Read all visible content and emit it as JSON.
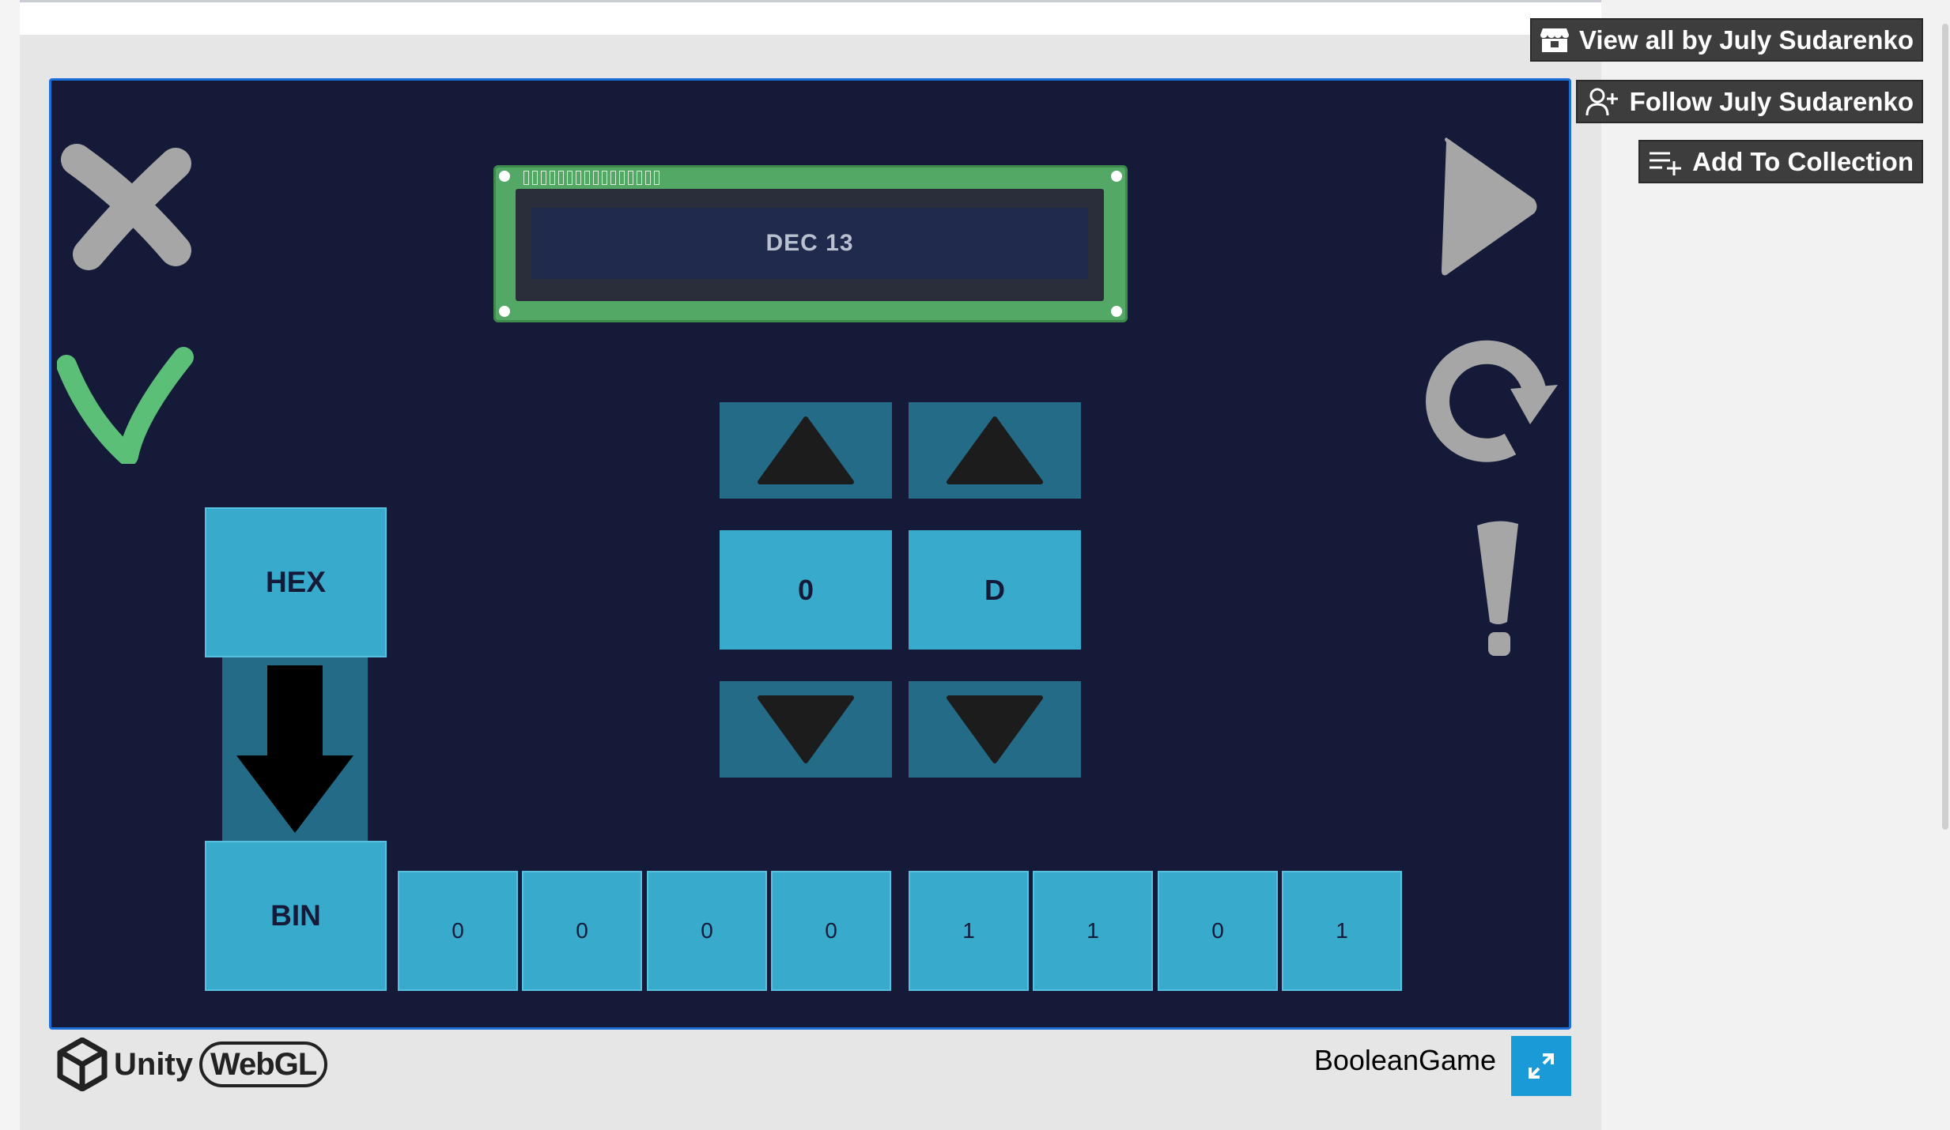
{
  "itch": {
    "view_all": "View all by July Sudarenko",
    "follow": "Follow July Sudarenko",
    "add_collection": "Add To Collection"
  },
  "game": {
    "lcd_text": "DEC 13",
    "source_base": "HEX",
    "target_base": "BIN",
    "digits": [
      "0",
      "D"
    ],
    "bits": [
      "0",
      "0",
      "0",
      "0",
      "1",
      "1",
      "0",
      "1"
    ],
    "icons": {
      "close": "close-icon",
      "check": "check-icon",
      "play": "play-icon",
      "restart": "restart-icon",
      "hint": "exclamation-icon",
      "convert": "arrow-down-icon"
    },
    "colors": {
      "background": "#141a38",
      "tile": "#38aacb",
      "arrow_tile": "#246b87",
      "lcd_board": "#52a864",
      "check": "#5bbf78",
      "grey_icon": "#a6a6a6"
    }
  },
  "footer": {
    "engine": "Unity",
    "platform": "WebGL",
    "game_name": "BooleanGame"
  }
}
